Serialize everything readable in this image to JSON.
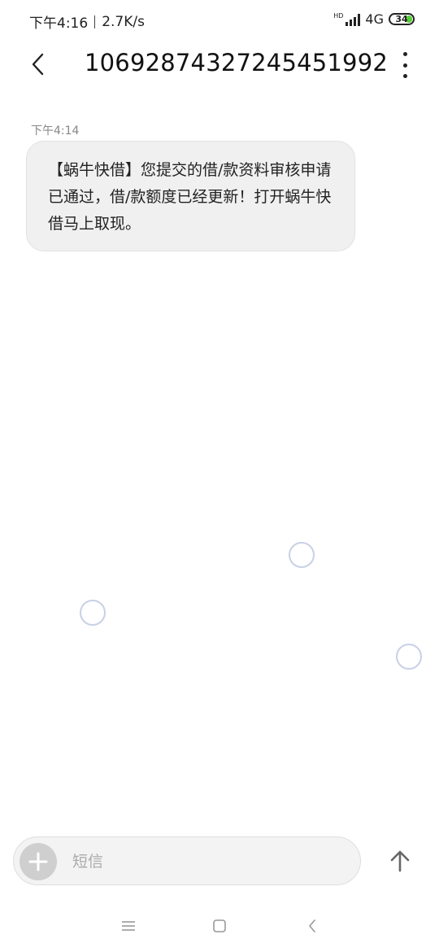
{
  "status_bar": {
    "time": "下午4:16",
    "speed": "2.7K/s",
    "hd": "HD",
    "network": "4G",
    "battery": "34"
  },
  "header": {
    "title": "10692874327245451992"
  },
  "messages": [
    {
      "timestamp": "下午4:14",
      "text": "【蜗牛快借】您提交的借/款资料审核申请已通过，借/款额度已经更新！打开蜗牛快借马上取现。"
    }
  ],
  "composer": {
    "placeholder": "短信"
  },
  "colors": {
    "bubble": "#f0f0f0",
    "battery_fill": "#57d037",
    "touch_ring": "#c9d0e6"
  },
  "icons": {
    "back": "chevron-left-icon",
    "more": "more-vertical-icon",
    "add": "plus-icon",
    "send": "arrow-up-icon",
    "nav_menu": "menu-icon",
    "nav_home": "square-icon",
    "nav_back": "chevron-left-icon"
  }
}
